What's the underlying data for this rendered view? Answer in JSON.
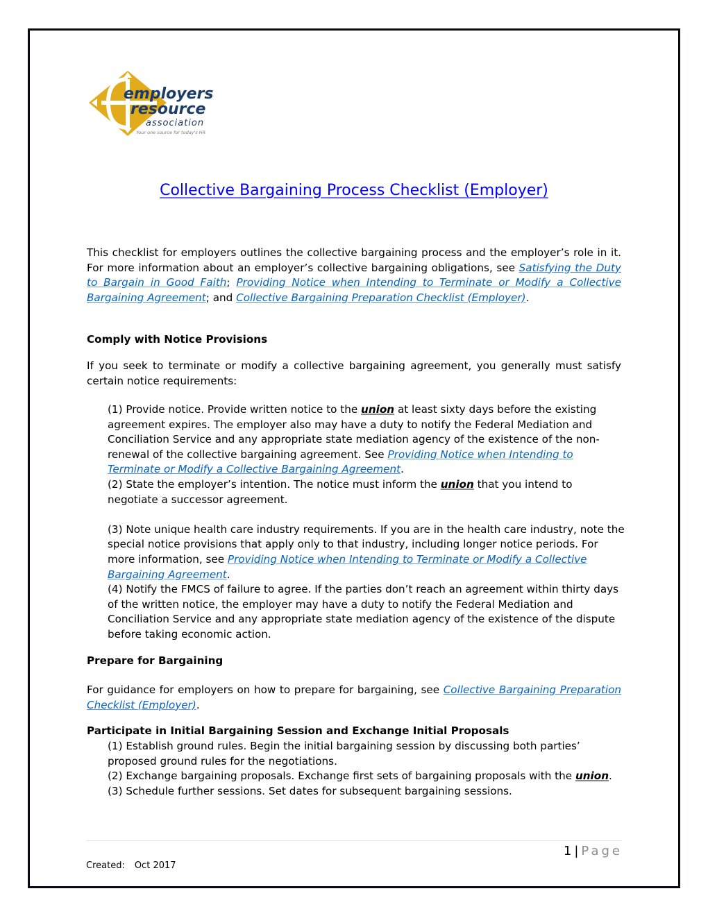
{
  "logo": {
    "line1": "employers",
    "line2": "resource",
    "line3": "association",
    "tagline": "Your one source for today's HR",
    "colors": {
      "gold": "#e2ab1b",
      "navy": "#1c3b66",
      "gray": "#7a7a7a"
    }
  },
  "title": "Collective Bargaining Process Checklist (Employer)",
  "intro": {
    "text_1": "This checklist for employers outlines the collective bargaining process and the employer’s role in it. For more information about an employer’s collective bargaining obligations, see ",
    "link_1": "Satisfying the Duty to Bargain in Good Faith",
    "sep_1": "; ",
    "link_2": "Providing Notice when Intending to Terminate or Modify a Collective Bargaining Agreement",
    "sep_2": "; and ",
    "link_3": "Collective Bargaining Preparation Checklist (Employer)",
    "end": "."
  },
  "section_notice": {
    "heading": "Comply with Notice Provisions",
    "intro": "If you seek to terminate or modify a collective bargaining agreement, you generally must satisfy certain notice requirements:",
    "item1": {
      "a": "(1) Provide notice. Provide written notice to the ",
      "union": "union",
      "b": " at least sixty days before the existing agreement expires. The employer also may have a duty to notify the Federal Mediation and Conciliation Service and any appropriate state mediation agency of the existence of the non-renewal of the collective bargaining agreement. See ",
      "link": "Providing Notice when Intending to Terminate or Modify a Collective Bargaining Agreement",
      "end": "."
    },
    "item2": {
      "a": "(2) State the employer’s intention. The notice must inform the ",
      "union": "union",
      "b": " that you intend to negotiate a successor agreement."
    },
    "item3": {
      "a": "(3) Note unique health care industry requirements. If you are in the health care industry, note the special notice provisions that apply only to that industry, including longer notice periods. For more information, see ",
      "link": "Providing Notice when Intending to Terminate or Modify a Collective Bargaining Agreement",
      "end": "."
    },
    "item4": "(4) Notify the FMCS of failure to agree. If the parties don’t reach an agreement within thirty days of the written notice, the employer may have a duty to notify the Federal Mediation and Conciliation Service and any appropriate state mediation agency of the existence of the dispute before taking economic action."
  },
  "section_prepare": {
    "heading": "Prepare for Bargaining",
    "text": "For guidance for employers on how to prepare for bargaining, see ",
    "link": "Collective Bargaining Preparation Checklist (Employer)",
    "end": "."
  },
  "section_initial": {
    "heading": "Participate in Initial Bargaining Session and Exchange Initial Proposals",
    "item1": "(1) Establish ground rules. Begin the initial bargaining session by discussing both parties’ proposed ground rules for the negotiations.",
    "item2": {
      "a": "(2) Exchange bargaining proposals. Exchange first sets of bargaining proposals with the ",
      "union": "union",
      "end": "."
    },
    "item3": "(3) Schedule further sessions. Set dates for subsequent bargaining sessions."
  },
  "footer": {
    "page_number": "1",
    "separator": "|",
    "page_word": "Page",
    "created_label": "Created:",
    "created_value": "Oct 2017"
  }
}
